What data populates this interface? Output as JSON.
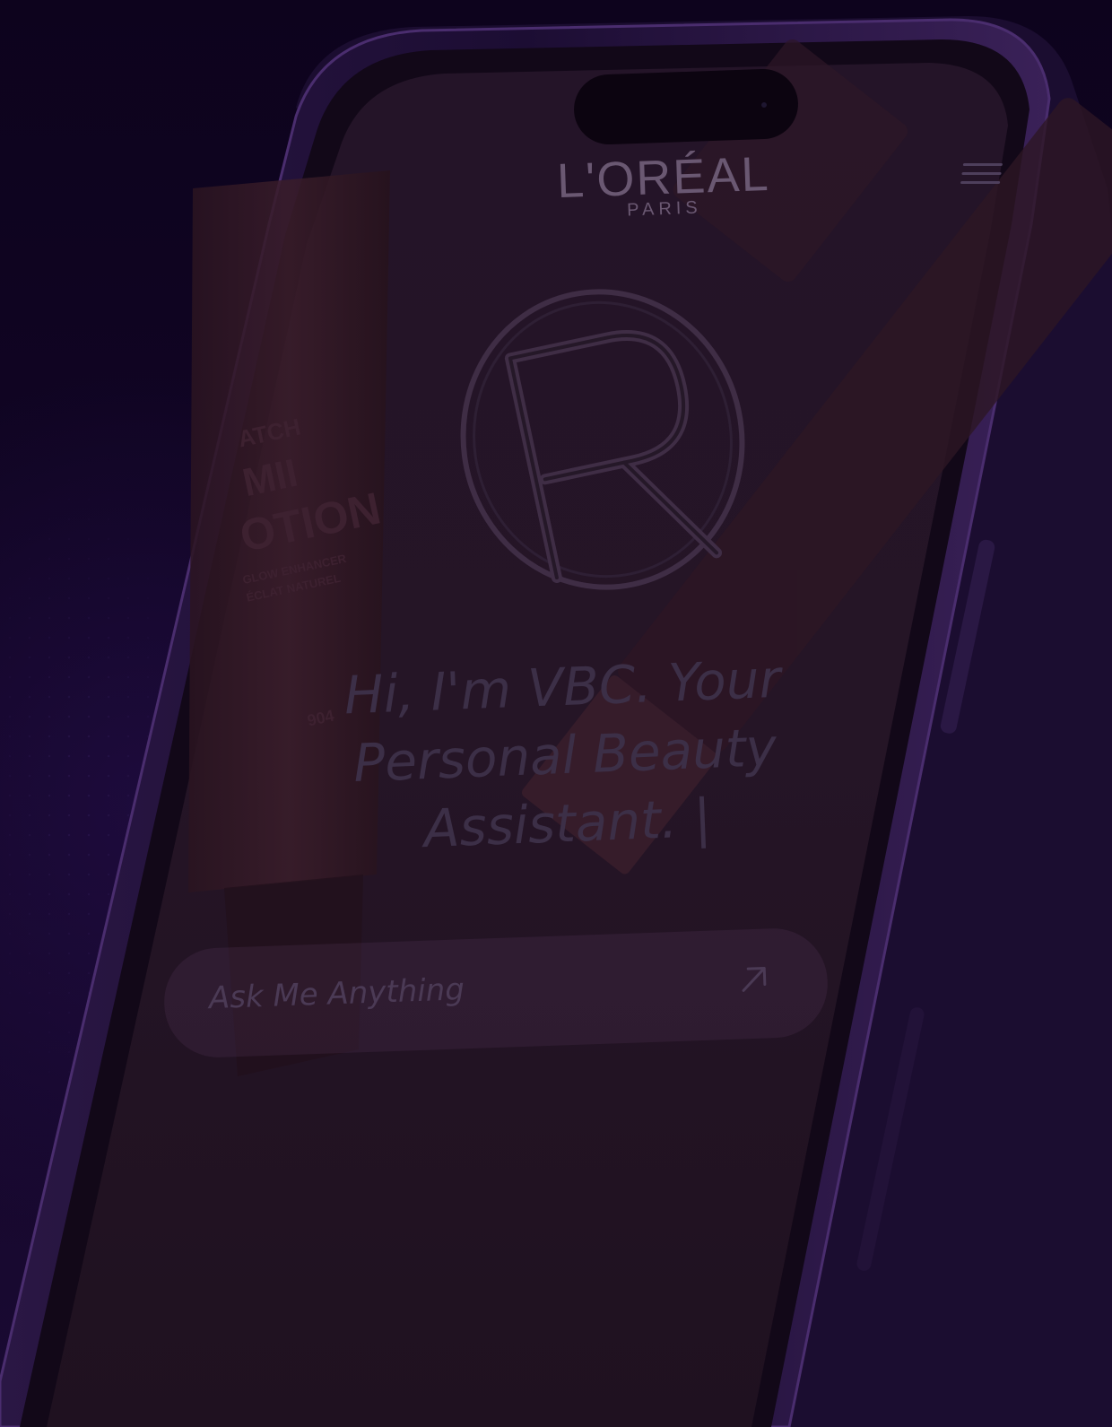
{
  "header": {
    "brand": "L'ORÉAL",
    "brand_sub": "PARIS",
    "menu_icon": "hamburger-menu-icon"
  },
  "hero": {
    "headline_line1": "Hi, I'm VBC. Your",
    "headline_line2": "Personal Beauty",
    "headline_line3": "Assistant. |",
    "emblem_icon": "r-monogram-emblem-icon"
  },
  "chat": {
    "placeholder": "Ask Me Anything",
    "send_icon": "arrow-up-right-icon"
  },
  "product_left": {
    "label_1": "ATCH",
    "label_2": "MII",
    "label_3": "OTION",
    "label_4": "GLOW ENHANCER",
    "label_5": "ÉCLAT NATUREL",
    "shade": "904"
  },
  "colors": {
    "background": "#0e0420",
    "accent_purple": "#5a2896",
    "text_muted": "#6a5872"
  }
}
